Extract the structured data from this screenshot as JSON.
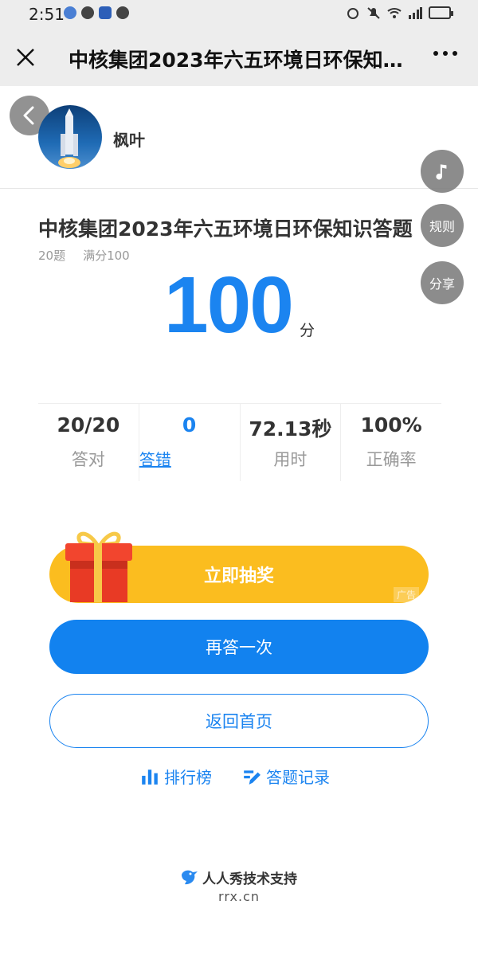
{
  "status_bar": {
    "time": "2:51"
  },
  "title_bar": {
    "title": "中核集团2023年六五环境日环保知..."
  },
  "header": {
    "username": "枫叶"
  },
  "float_buttons": {
    "rules": "规则",
    "share": "分享"
  },
  "quiz": {
    "title": "中核集团2023年六五环境日环保知识答题",
    "question_count": "20题",
    "full_score": "满分100",
    "score": "100",
    "score_unit": "分"
  },
  "stats": [
    {
      "value": "20/20",
      "label": "答对"
    },
    {
      "value": "0",
      "label": "答错"
    },
    {
      "value": "72.13秒",
      "label": "用时"
    },
    {
      "value": "100%",
      "label": "正确率"
    }
  ],
  "buttons": {
    "lottery": "立即抽奖",
    "ad_tag": "广告",
    "retry": "再答一次",
    "home": "返回首页"
  },
  "links": {
    "ranking": "排行榜",
    "records": "答题记录"
  },
  "footer": {
    "brand": "人人秀技术支持",
    "url": "rrx.cn"
  },
  "colors": {
    "primary": "#1b84f0",
    "lottery": "#fbbd1f",
    "gift": "#f2452e"
  },
  "icons": [
    "close-icon",
    "more-icon",
    "back-icon",
    "music-icon",
    "bar-chart-icon",
    "edit-icon",
    "bird-logo-icon",
    "gift-icon"
  ]
}
